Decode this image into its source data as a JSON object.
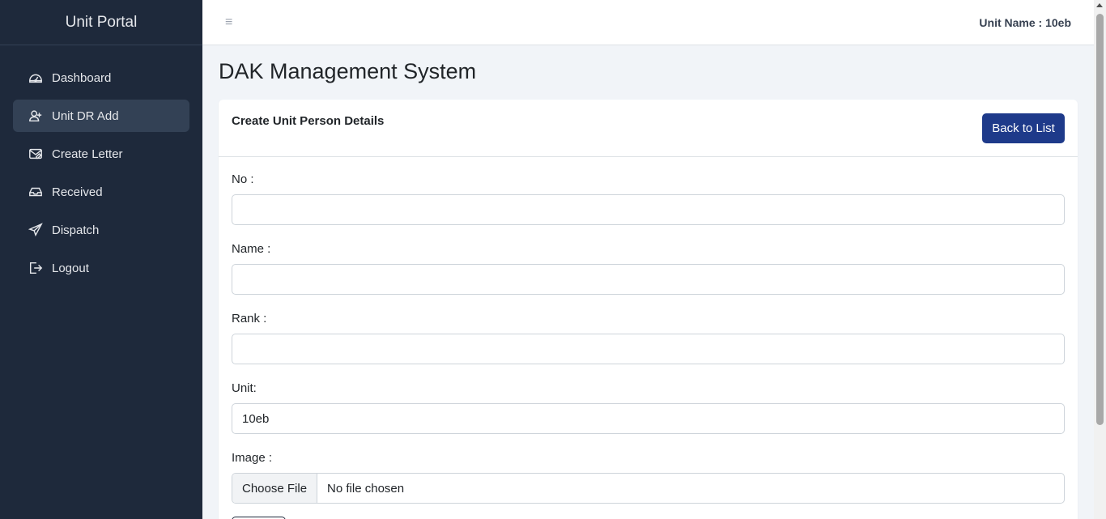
{
  "sidebar": {
    "brand": "Unit Portal",
    "items": [
      {
        "label": "Dashboard",
        "icon": "dashboard-icon"
      },
      {
        "label": "Unit DR Add",
        "icon": "user-plus-icon"
      },
      {
        "label": "Create Letter",
        "icon": "envelope-icon"
      },
      {
        "label": "Received",
        "icon": "inbox-icon"
      },
      {
        "label": "Dispatch",
        "icon": "send-icon"
      },
      {
        "label": "Logout",
        "icon": "logout-icon"
      }
    ],
    "active_index": 1
  },
  "topbar": {
    "toggle_glyph": "≡",
    "unit_name": "Unit Name : 10eb"
  },
  "page": {
    "title": "DAK Management System"
  },
  "card": {
    "title": "Create Unit Person Details",
    "back_button": "Back to List"
  },
  "form": {
    "no_label": "No :",
    "no_value": "",
    "name_label": "Name :",
    "name_value": "",
    "rank_label": "Rank :",
    "rank_value": "",
    "unit_label": "Unit:",
    "unit_value": "10eb",
    "image_label": "Image :",
    "file_button": "Choose File",
    "file_status": "No file chosen"
  },
  "colors": {
    "sidebar_bg": "#1e293b",
    "sidebar_active": "#334155",
    "primary_button": "#1e3a8a",
    "page_bg": "#f1f4f8"
  }
}
